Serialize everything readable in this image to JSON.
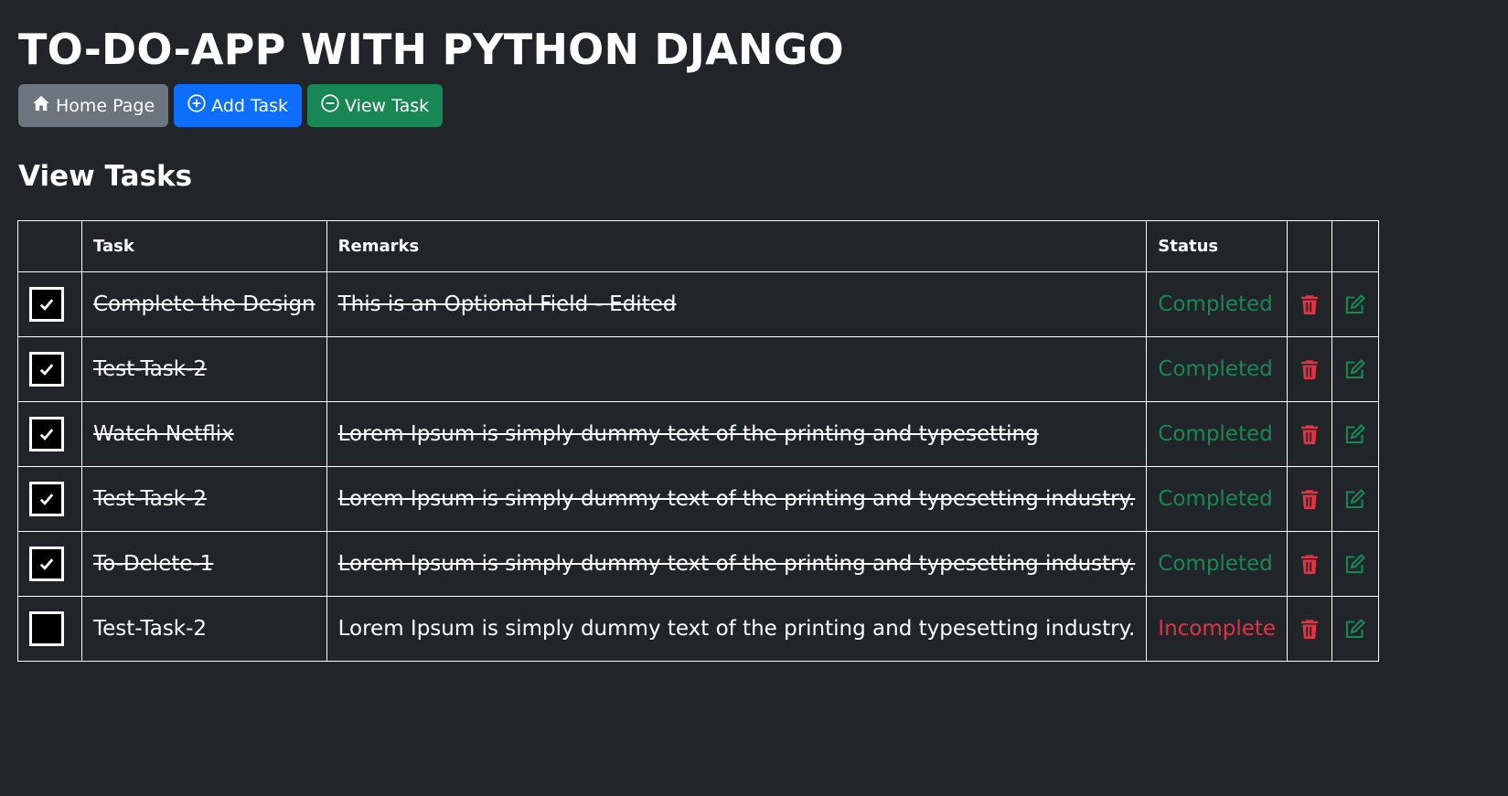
{
  "header": {
    "title": "TO-DO-APP WITH PYTHON DJANGO"
  },
  "nav": {
    "home_label": "Home Page",
    "add_label": "Add Task",
    "view_label": "View Task"
  },
  "section": {
    "title": "View Tasks"
  },
  "table": {
    "columns": [
      "",
      "Task",
      "Remarks",
      "Status",
      "",
      ""
    ],
    "rows": [
      {
        "checked": true,
        "task": "Complete the Design",
        "remarks": "This is an Optional Field - Edited",
        "status": "Completed"
      },
      {
        "checked": true,
        "task": "Test-Task-2",
        "remarks": "",
        "status": "Completed"
      },
      {
        "checked": true,
        "task": "Watch Netflix",
        "remarks": "Lorem Ipsum is simply dummy text of the printing and typesetting",
        "status": "Completed"
      },
      {
        "checked": true,
        "task": "Test-Task-2",
        "remarks": "Lorem Ipsum is simply dummy text of the printing and typesetting industry.",
        "status": "Completed"
      },
      {
        "checked": true,
        "task": "To-Delete-1",
        "remarks": "Lorem Ipsum is simply dummy text of the printing and typesetting industry.",
        "status": "Completed"
      },
      {
        "checked": false,
        "task": "Test-Task-2",
        "remarks": "Lorem Ipsum is simply dummy text of the printing and typesetting industry.",
        "status": "Incomplete"
      }
    ]
  },
  "icons": {
    "home": "house-icon",
    "add": "plus-circle-icon",
    "view": "dash-circle-icon",
    "check": "check-icon",
    "delete": "trash-icon",
    "edit": "pencil-square-icon"
  },
  "colors": {
    "background": "#212529",
    "home_button": "#6c757d",
    "add_button": "#0d6efd",
    "view_button": "#198754",
    "completed": "#198754",
    "incomplete": "#dc3545",
    "delete_icon": "#dc3545",
    "edit_icon": "#198754"
  }
}
